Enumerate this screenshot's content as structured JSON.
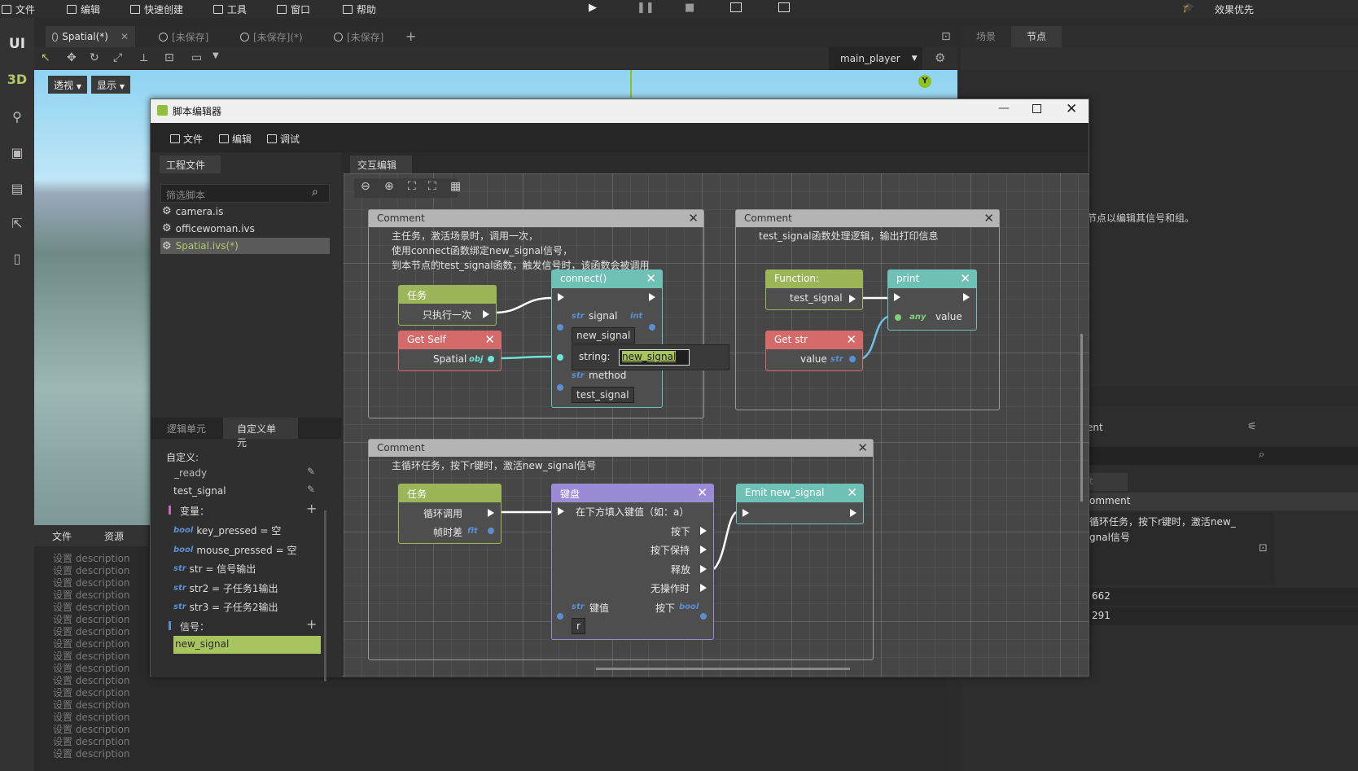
{
  "menubar": {
    "items": [
      "文件",
      "编辑",
      "快速创建",
      "工具",
      "窗口",
      "帮助"
    ],
    "right_label": "效果优先"
  },
  "sidebar": {
    "ui": "UI",
    "three_d": "3D"
  },
  "doc_tabs": [
    {
      "label": "Spatial(*)"
    },
    {
      "label": "[未保存]"
    },
    {
      "label": "[未保存](*)"
    },
    {
      "label": "[未保存]"
    }
  ],
  "right_tabs": [
    "场景",
    "节点"
  ],
  "viewport": {
    "view_btn": "透视",
    "show_btn": "显示",
    "player_select": "main_player",
    "axis_label": "Y"
  },
  "right_panel": {
    "hint": "节点以编辑其信号和组。",
    "section": "ent",
    "comment_label": "omment",
    "comment_text": "循环任务，按下r键时，激活new_\ngnal信号",
    "num1": "662",
    "num2": "291",
    "t_label": "t"
  },
  "bottom": {
    "tabs": [
      "文件",
      "资源"
    ],
    "desc_line": "设置 description"
  },
  "editor": {
    "title": "脚本编辑器",
    "menu": [
      "文件",
      "编辑",
      "调试"
    ],
    "proj_tab": "工程文件",
    "interact_tab": "交互编辑",
    "filter_placeholder": "筛选脚本",
    "files": [
      "camera.is",
      "officewoman.ivs",
      "Spatial.ivs(*)"
    ],
    "unit_tabs": [
      "逻辑单元",
      "自定义单元"
    ],
    "custom_label": "自定义:",
    "funcs": [
      "_ready",
      "test_signal"
    ],
    "var_header": "变量：",
    "vars": [
      {
        "type": "bool",
        "text": "key_pressed = 空"
      },
      {
        "type": "bool",
        "text": "mouse_pressed = 空"
      },
      {
        "type": "str",
        "text": "str = 信号输出"
      },
      {
        "type": "str",
        "text": "str2 = 子任务1输出"
      },
      {
        "type": "str",
        "text": "str3 = 子任务2输出"
      }
    ],
    "signal_header": "信号：",
    "signals": [
      "new_signal"
    ]
  },
  "graph": {
    "c1": {
      "title": "Comment",
      "text": [
        "主任务，激活场景时，调用一次，",
        "使用connect函数绑定new_signal信号，",
        "到本节点的test_signal函数，触发信号时，该函数会被调用"
      ]
    },
    "c2": {
      "title": "Comment",
      "text": [
        "test_signal函数处理逻辑，输出打印信息"
      ]
    },
    "c3": {
      "title": "Comment",
      "text": [
        "主循环任务，按下r键时，激活new_signal信号"
      ]
    },
    "task1": {
      "title": "任务",
      "out": "只执行一次"
    },
    "getself": {
      "title": "Get Self",
      "out": "Spatial",
      "type": "obj"
    },
    "connect": {
      "title": "connect()",
      "signal": "signal",
      "signal_type": "str",
      "int_type": "int",
      "signal_val": "new_signal",
      "method": "method",
      "method_val": "test_signal",
      "popup_label": "string:",
      "popup_val": "new_signal"
    },
    "func": {
      "title": "Function:",
      "out": "test_signal"
    },
    "print": {
      "title": "print",
      "in": "value",
      "type": "any"
    },
    "getstr": {
      "title": "Get str",
      "out": "value",
      "type": "str"
    },
    "task2": {
      "title": "任务",
      "out1": "循环调用",
      "out2": "帧时差",
      "type": "flt"
    },
    "keyboard": {
      "title": "键盘",
      "hint": "在下方填入键值（如：a）",
      "outs": [
        "按下",
        "按下保持",
        "释放",
        "无操作时"
      ],
      "key_label": "键值",
      "key_type": "str",
      "pressed": "按下",
      "pressed_type": "bool",
      "key_val": "r"
    },
    "emit": {
      "title": "Emit new_signal"
    }
  },
  "colors": {
    "green": "#9ab659",
    "red": "#d56a6a",
    "teal": "#6fc1b5",
    "purple": "#9b8ad6",
    "highlight": "#a7c45f",
    "accent_blue": "#5b8fd1"
  }
}
